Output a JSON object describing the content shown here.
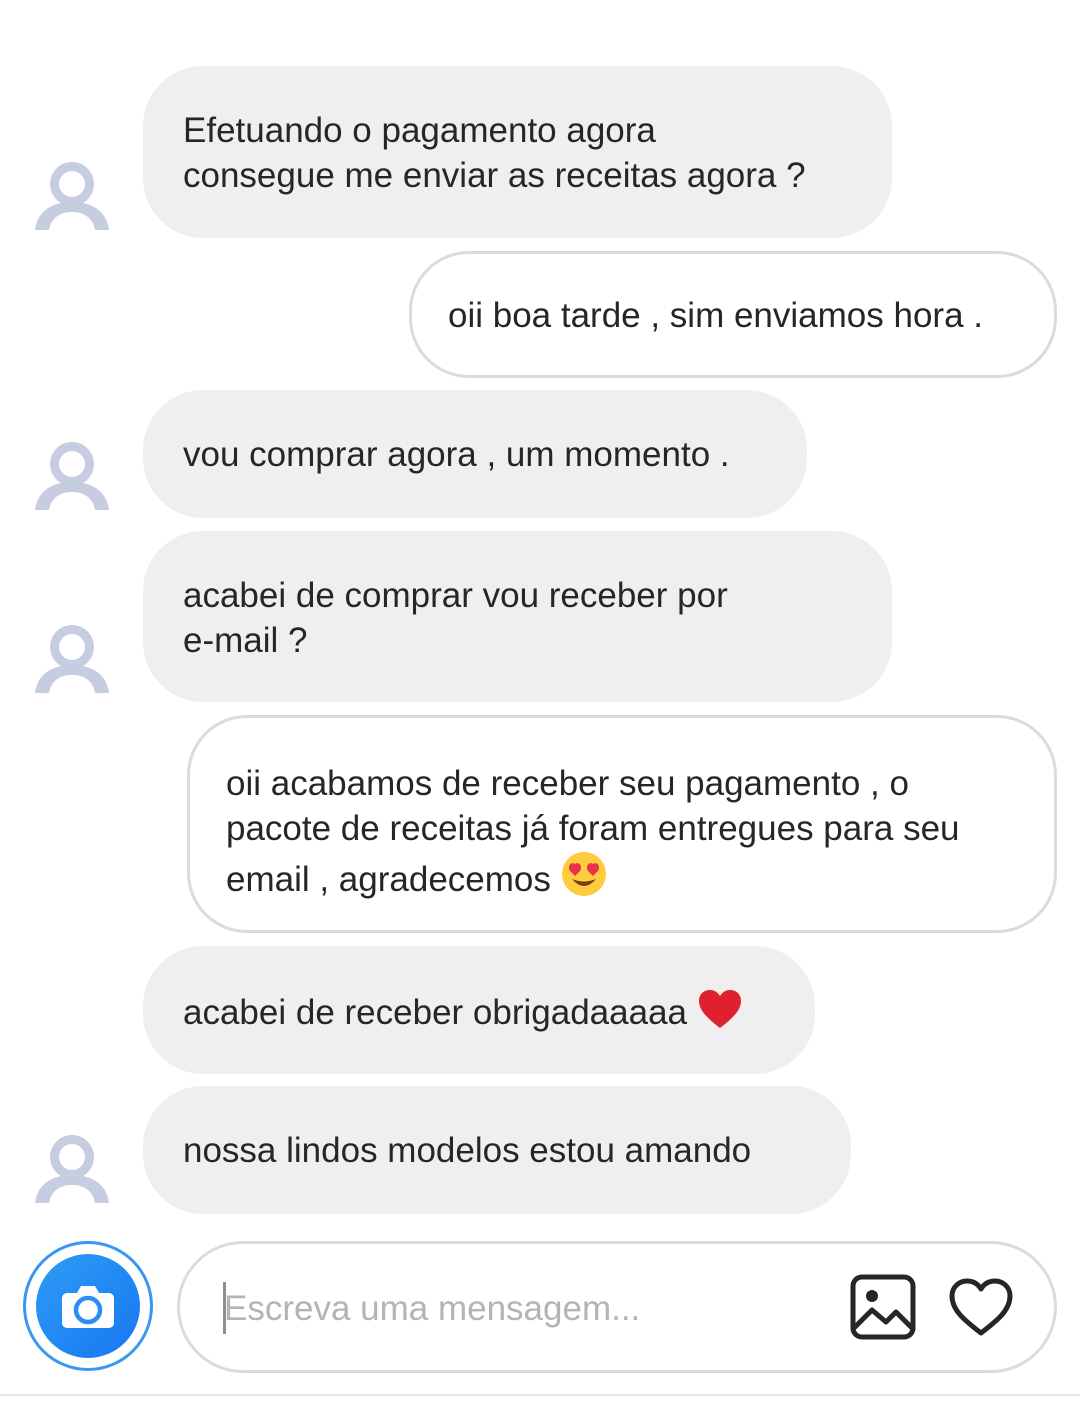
{
  "messages": [
    {
      "from": "them",
      "text": "Efetuando o pagamento agora\nconsegue me enviar as receitas agora ?",
      "avatar_icon": "default-avatar-icon"
    },
    {
      "from": "me",
      "text": "oii boa tarde , sim enviamos hora ."
    },
    {
      "from": "them",
      "text": "vou comprar agora , um momento .",
      "avatar_icon": "default-avatar-icon"
    },
    {
      "from": "them",
      "text": "acabei de comprar vou receber por\ne-mail ?",
      "avatar_icon": "default-avatar-icon"
    },
    {
      "from": "me",
      "text": "oii acabamos de receber seu pagamento , o\npacote de receitas já foram entregues para seu\nemail , agradecemos",
      "emoji": "heart-eyes-emoji"
    },
    {
      "from": "them",
      "text": "acabei de receber obrigadaaaaa",
      "emoji": "red-heart-emoji"
    },
    {
      "from": "them",
      "text": "nossa lindos modelos estou amando",
      "avatar_icon": "default-avatar-icon"
    }
  ],
  "composer": {
    "placeholder": "Escreva uma mensagem...",
    "camera_icon": "camera-icon",
    "gallery_icon": "gallery-icon",
    "like_icon": "heart-outline-icon"
  },
  "colors": {
    "incoming_bubble": "#efefef",
    "outgoing_border": "#dbdbdb",
    "camera_accent": "#1877f2",
    "avatar": "#c7cde0"
  }
}
